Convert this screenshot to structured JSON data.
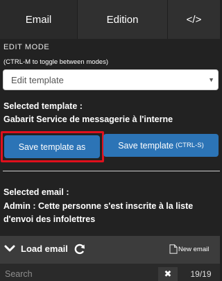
{
  "tabs": [
    {
      "label": "Email",
      "active": true
    },
    {
      "label": "Edition",
      "active": false
    },
    {
      "label": "</>",
      "active": false
    }
  ],
  "edit_mode": {
    "title": "EDIT MODE",
    "hint": "(CTRL-M to toggle between modes)",
    "select_value": "Edit template"
  },
  "template": {
    "label": "Selected template :",
    "name": "Gabarit Service de messagerie à l'interne"
  },
  "buttons": {
    "save_as": "Save template as",
    "save": "Save template",
    "save_shortcut": "(CTRL-S)"
  },
  "email": {
    "label": "Selected email :",
    "value": "Admin : Cette personne s'est inscrite à la liste d'envoi des infolettres"
  },
  "load": {
    "label": "Load email",
    "new_email": "New email"
  },
  "search": {
    "placeholder": "Search",
    "clear": "✖",
    "count": "19/19"
  },
  "colors": {
    "primary": "#2c74b6",
    "highlight": "#e0101c",
    "background": "#222222"
  }
}
